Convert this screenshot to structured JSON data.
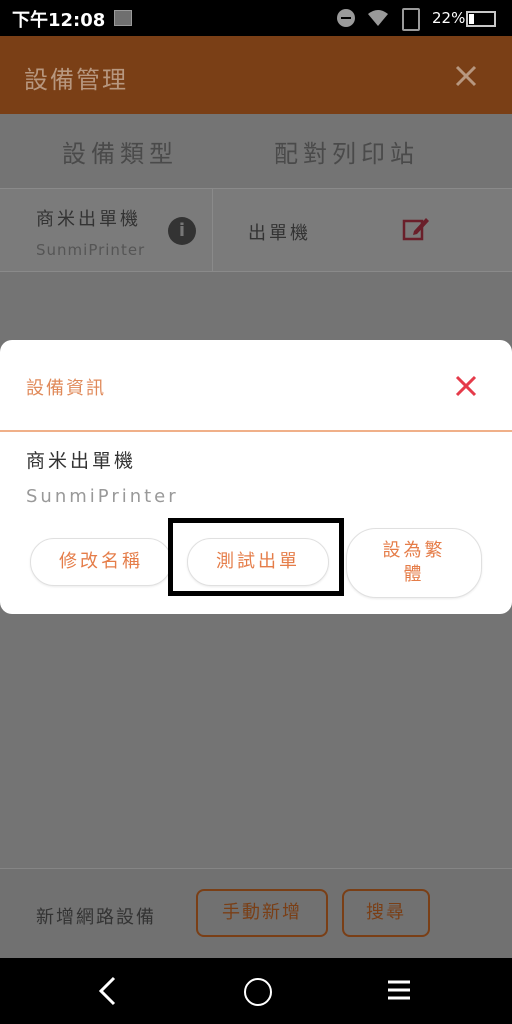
{
  "status_bar": {
    "time": "下午12:08",
    "battery_percent": "22%"
  },
  "app_bar": {
    "title": "設備管理"
  },
  "tabs": [
    {
      "label": "設備類型"
    },
    {
      "label": "配對列印站"
    }
  ],
  "device_row": {
    "name": "商米出單機",
    "model": "SunmiPrinter",
    "type": "出單機"
  },
  "bottom_bar": {
    "label": "新增網路設備",
    "manual_add": "手動新增",
    "search": "搜尋"
  },
  "modal": {
    "title": "設備資訊",
    "device_name": "商米出單機",
    "device_model": "SunmiPrinter",
    "buttons": {
      "rename": "修改名稱",
      "test_print": "測試出單",
      "set_traditional_line1": "設為繁",
      "set_traditional_line2": "體"
    }
  },
  "colors": {
    "accent": "#e57d49",
    "close_red": "#e53b4a",
    "app_bar": "#7a3f16"
  }
}
